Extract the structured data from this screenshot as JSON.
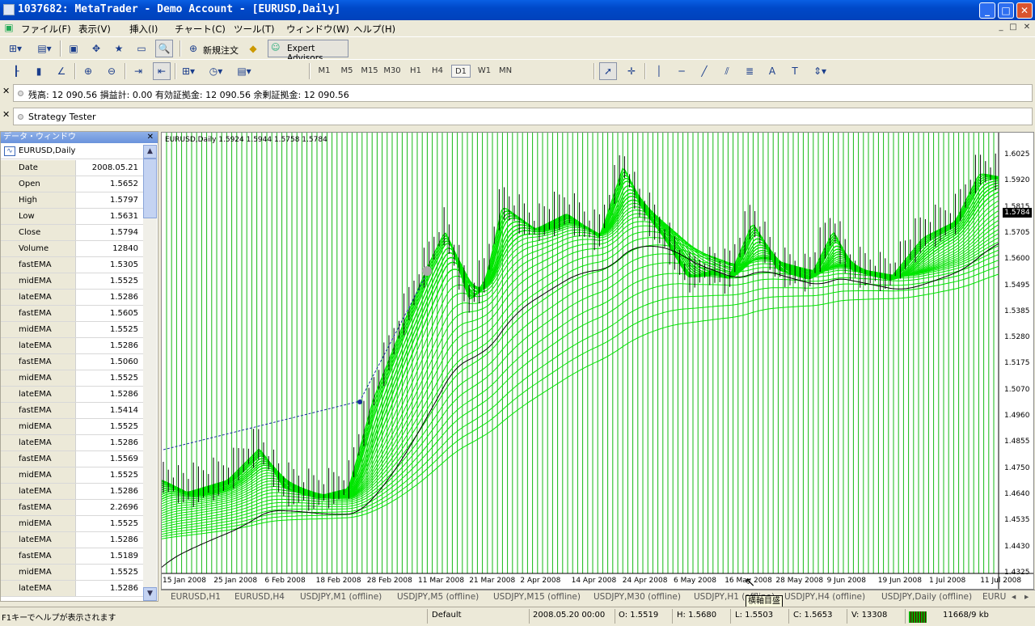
{
  "window": {
    "title": "1037682: MetaTrader - Demo Account - [EURUSD,Daily]",
    "buttons": {
      "minimize": "_",
      "maximize": "□",
      "close": "✕"
    }
  },
  "menu": {
    "items": [
      "ファイル(F)",
      "表示(V)",
      "挿入(I)",
      "チャート(C)",
      "ツール(T)",
      "ウィンドウ(W)",
      "ヘルプ(H)"
    ],
    "mdi": [
      "_",
      "□",
      "✕"
    ]
  },
  "toolbar1": {
    "new_order": "新規注文",
    "expert_advisors": "Expert Advisors"
  },
  "toolbar2": {
    "timeframes": [
      "M1",
      "M5",
      "M15",
      "M30",
      "H1",
      "H4",
      "D1",
      "W1",
      "MN"
    ],
    "selected_timeframe": "D1"
  },
  "account_bar": {
    "close": "✕",
    "text": "残高: 12 090.56  損益計: 0.00  有効証拠金: 12 090.56  余剰証拠金: 12 090.56"
  },
  "tester_bar": {
    "close": "✕",
    "text": "Strategy Tester"
  },
  "data_window": {
    "title": "データ・ウィンドウ",
    "close": "✕",
    "symbol": "EURUSD,Daily",
    "rows": [
      {
        "label": "Date",
        "value": "2008.05.21",
        "indicator": false
      },
      {
        "label": "Open",
        "value": "1.5652",
        "indicator": false
      },
      {
        "label": "High",
        "value": "1.5797",
        "indicator": false
      },
      {
        "label": "Low",
        "value": "1.5631",
        "indicator": false
      },
      {
        "label": "Close",
        "value": "1.5794",
        "indicator": false
      },
      {
        "label": "Volume",
        "value": "12840",
        "indicator": false
      },
      {
        "label": "fastEMA",
        "value": "1.5305",
        "indicator": true
      },
      {
        "label": "midEMA",
        "value": "1.5525",
        "indicator": true
      },
      {
        "label": "lateEMA",
        "value": "1.5286",
        "indicator": true
      },
      {
        "label": "fastEMA",
        "value": "1.5605",
        "indicator": true
      },
      {
        "label": "midEMA",
        "value": "1.5525",
        "indicator": true
      },
      {
        "label": "lateEMA",
        "value": "1.5286",
        "indicator": true
      },
      {
        "label": "fastEMA",
        "value": "1.5060",
        "indicator": true
      },
      {
        "label": "midEMA",
        "value": "1.5525",
        "indicator": true
      },
      {
        "label": "lateEMA",
        "value": "1.5286",
        "indicator": true
      },
      {
        "label": "fastEMA",
        "value": "1.5414",
        "indicator": true
      },
      {
        "label": "midEMA",
        "value": "1.5525",
        "indicator": true
      },
      {
        "label": "lateEMA",
        "value": "1.5286",
        "indicator": true
      },
      {
        "label": "fastEMA",
        "value": "1.5569",
        "indicator": true
      },
      {
        "label": "midEMA",
        "value": "1.5525",
        "indicator": true
      },
      {
        "label": "lateEMA",
        "value": "1.5286",
        "indicator": true
      },
      {
        "label": "fastEMA",
        "value": "2.2696",
        "indicator": true
      },
      {
        "label": "midEMA",
        "value": "1.5525",
        "indicator": true
      },
      {
        "label": "lateEMA",
        "value": "1.5286",
        "indicator": true
      },
      {
        "label": "fastEMA",
        "value": "1.5189",
        "indicator": true
      },
      {
        "label": "midEMA",
        "value": "1.5525",
        "indicator": true
      },
      {
        "label": "lateEMA",
        "value": "1.5286",
        "indicator": true
      }
    ]
  },
  "chart": {
    "header": "EURUSD,Daily  1.5924 1.5944 1.5758 1.5784",
    "current_price": "1.5784",
    "price_labels": [
      "1.6025",
      "1.5920",
      "1.5815",
      "1.5705",
      "1.5600",
      "1.5495",
      "1.5385",
      "1.5280",
      "1.5175",
      "1.5070",
      "1.4960",
      "1.4855",
      "1.4750",
      "1.4640",
      "1.4535",
      "1.4430",
      "1.4325"
    ],
    "date_labels": [
      "15 Jan 2008",
      "25 Jan 2008",
      "6 Feb 2008",
      "18 Feb 2008",
      "28 Feb 2008",
      "11 Mar 2008",
      "21 Mar 2008",
      "2 Apr 2008",
      "14 Apr 2008",
      "24 Apr 2008",
      "6 May 2008",
      "16 May 2008",
      "28 May 2008",
      "9 Jun 2008",
      "19 Jun 2008",
      "1 Jul 2008",
      "11 Jul 2008"
    ],
    "colors": {
      "ema": "#00e600",
      "grid": "#16b816",
      "candle": "#000000",
      "label_bg": "#000000"
    }
  },
  "chart_tabs": [
    "EURUSD,H1",
    "EURUSD,H4",
    "USDJPY,M1 (offline)",
    "USDJPY,M5 (offline)",
    "USDJPY,M15 (offline)",
    "USDJPY,M30 (offline)",
    "USDJPY,H1 (offline)",
    "USDJPY,H4 (offline)",
    "USDJPY,Daily (offline)",
    "EURU"
  ],
  "tooltip": "横軸目盛",
  "status": {
    "help": "F1キーでヘルプが表示されます",
    "profile": "Default",
    "datetime": "2008.05.20 00:00",
    "open": "O: 1.5519",
    "high": "H: 1.5680",
    "low": "L: 1.5503",
    "close": "C: 1.5653",
    "volume": "V: 13308",
    "traffic": "11668/9 kb"
  }
}
